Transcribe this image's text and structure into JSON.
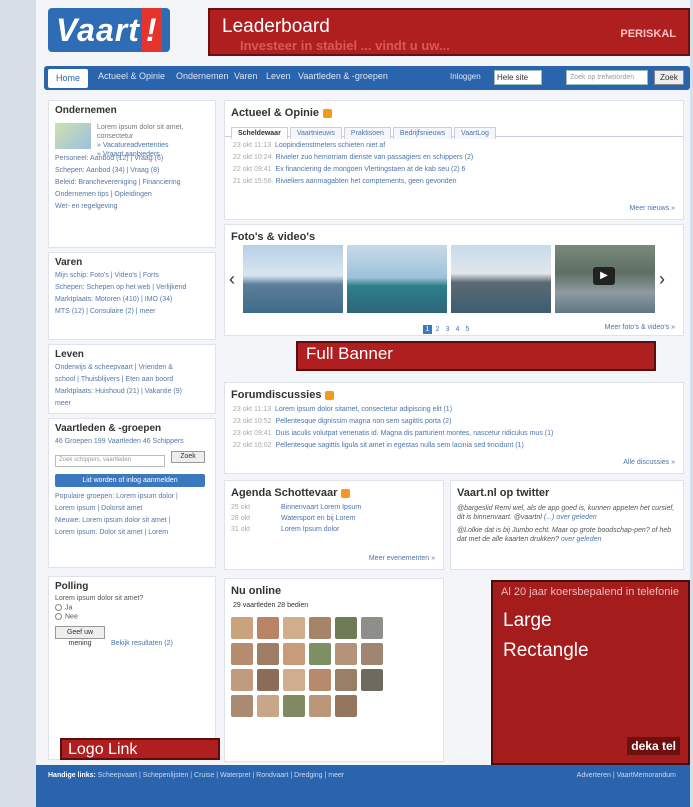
{
  "header": {
    "logo_text": "Vaart",
    "logo_bang": "!",
    "leaderboard_label": "Leaderboard",
    "leaderboard_ghost_text": "Investeer in stabiel ... vindt u uw...",
    "leaderboard_brand": "PERISKAL"
  },
  "nav": {
    "home": "Home",
    "items": [
      "Actueel & Opinie",
      "Ondernemen",
      "Varen",
      "Leven",
      "Vaartleden & -groepen"
    ],
    "login_label": "Inloggen",
    "select_value": "Hele site",
    "search_placeholder": "Zoek op trefwoorden",
    "search_button": "Zoek"
  },
  "left": {
    "ondernemen": {
      "title": "Ondernemen",
      "side_text": "Lorem ipsum dolor sit amet, consectetur",
      "side_links": [
        "» Vacatureadvertenties",
        "» Vraagt aanbieders"
      ],
      "rows": [
        "Personeel: Aanbod (12) | Vraag (6)",
        "Schepen: Aanbod (34) | Vraag (8)",
        "Beleid: Branchevereniging | Financiering",
        "Ondernemen tips | Opleidingen",
        "Wet- en regelgeving"
      ]
    },
    "varen": {
      "title": "Varen",
      "rows": [
        "Mijn schip: Foto's | Video's | Forts",
        "Schepen: Schepen op het web | Verlijkend",
        "Marktplaats: Motoren (410) | IMO (34)",
        "MTS (12) | Consulaire (2) | meer"
      ]
    },
    "leven": {
      "title": "Leven",
      "rows": [
        "Onderwijs & scheepvaart | Vrienden &",
        "school | Thuisblijvers | Eten aan boord",
        "Marktplaats: Huishoud (21) | Vakantie (9)",
        "meer"
      ]
    },
    "vaartleden": {
      "title": "Vaartleden & -groepen",
      "counts": "46 Groepen  199 Vaartleden  46 Schippers",
      "search_placeholder": "Zoek schippers, vaartleden",
      "search_button": "Zoek",
      "join_button": "Lid worden of inlog aanmelden",
      "rows": [
        "Populaire groepen: Lorem ipsum dolor |",
        "Lorem ipsum | Dolorsit amet",
        "Nieuwe: Lorem ipsum dolor sit amet |",
        "Lorem ipsum. Dolor sit amet | Lorem"
      ]
    },
    "polling": {
      "title": "Polling",
      "question": "Lorem ipsum dolor sit amet?",
      "options": [
        "Ja",
        "Nee"
      ],
      "submit": "Geef uw mening",
      "results": "Bekijk resultaten (2)"
    },
    "logo_link_label": "Logo Link"
  },
  "main": {
    "actueel": {
      "title": "Actueel & Opinie",
      "tabs": [
        "Scheldewaar",
        "Vaartnieuws",
        "Praktisoen",
        "Bedrijfsnieuws",
        "VaartLog"
      ],
      "items": [
        {
          "time": "23 okt 11:13",
          "text": "Loopindienstmeters schieten niet af"
        },
        {
          "time": "22 okt 10:24",
          "text": "Rivieler zuo hemorriam dienste van passagiers en schippers (2)"
        },
        {
          "time": "22 okt 09:41",
          "text": "Ex financiering de mongoen Vlertingstaen at de kab seu (2) 6"
        },
        {
          "time": "21 okt 15:56",
          "text": "Rivieliers aanmagabten het comptements, geen gevonden"
        }
      ],
      "more": "Meer nieuws »"
    },
    "fotos": {
      "title": "Foto's & video's",
      "pages": [
        "1",
        "2",
        "3",
        "4",
        "5"
      ],
      "more": "Meer foto's & video's »"
    },
    "full_banner_label": "Full Banner",
    "forum": {
      "title": "Forumdiscussies",
      "items": [
        {
          "time": "23 okt 11:13",
          "text": "Lorem ipsum dolor sitamet, consectetur adipiscing elit (1)"
        },
        {
          "time": "23 okt 10:52",
          "text": "Pellentesque dignissim magna non sem sagittis porta (2)"
        },
        {
          "time": "23 okt 09:41",
          "text": "Duis iaculis volutpat venenatis id. Magna dis parturient montes, nascetur ridiculus mus (1)"
        },
        {
          "time": "22 okt 16:02",
          "text": "Pellentesque sagittis ligula sit amet in egestas nulla sem lacinia sed tincidunt (1)"
        }
      ],
      "more": "Alle discussies »"
    },
    "agenda": {
      "title": "Agenda Schottevaar",
      "items": [
        {
          "date": "25 okt",
          "text": "Binnenvaart Lorem Ipsum"
        },
        {
          "date": "28 okt",
          "text": "Watersport en bij Lorem"
        },
        {
          "date": "31 okt",
          "text": "Lorem Ipsum dolor"
        }
      ],
      "more": "Meer evenementen »"
    },
    "twitter": {
      "title": "Vaart.nl op twitter",
      "tweets": [
        {
          "text": "@bargeslid Remi wel, als de app goed is, kunnen appeten het cursief, dit is binnenvaart. @vaartnl",
          "meta": "(...) over geleden"
        },
        {
          "text": "@Lolkie dat is bij Jumbo echt. Maar op grote boodschap-pen? of heb dat met de alle kaarten drukken?",
          "meta": "over geleden"
        }
      ]
    },
    "online": {
      "title": "Nu online",
      "counts": "29 vaartleden  28 bedien"
    },
    "large_rect": {
      "top_text": "Al 20 jaar koersbepalend in telefonie",
      "label_line1": "Large",
      "label_line2": "Rectangle",
      "brand": "deka tel"
    }
  },
  "footer": {
    "links_title": "Handige links:",
    "links": "Scheepvaart | Schepenlijsten | Cruise | Waterpret | Rondvaart | Dredging | meer",
    "right": "Adverteren | VaartMemorandum"
  },
  "colors": {
    "brand_blue": "#2a64ad",
    "ad_red": "#b01f1f",
    "rss_orange": "#f39a1e"
  }
}
